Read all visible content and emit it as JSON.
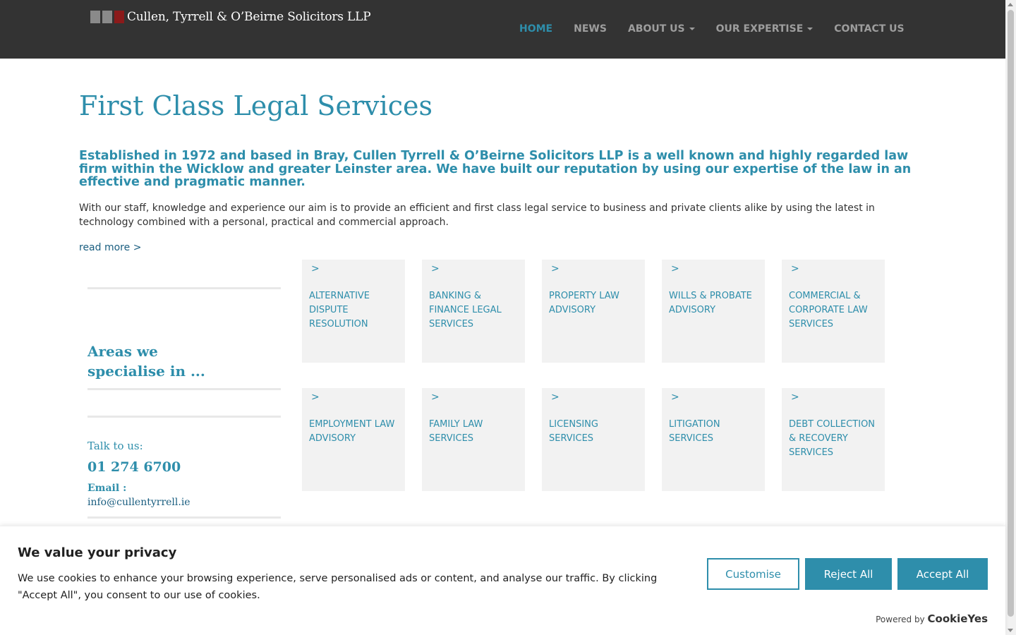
{
  "header": {
    "logo_text": "Cullen, Tyrrell & O’Beirne Solicitors LLP",
    "nav": [
      {
        "label": "HOME",
        "active": true,
        "dropdown": false
      },
      {
        "label": "NEWS",
        "active": false,
        "dropdown": false
      },
      {
        "label": "ABOUT US",
        "active": false,
        "dropdown": true
      },
      {
        "label": "OUR EXPERTISE",
        "active": false,
        "dropdown": true
      },
      {
        "label": "CONTACT US",
        "active": false,
        "dropdown": false
      }
    ]
  },
  "main": {
    "title": "First Class Legal Services",
    "lead": "Established in 1972 and based in Bray, Cullen Tyrrell & O’Beirne Solicitors LLP is a well known and highly regarded law firm within the Wicklow and greater Leinster area. We have built our reputation by using our expertise of the law in an effective and pragmatic manner.",
    "body": "With our staff, knowledge and experience our aim is to provide an efficient and first class legal service to business and private clients alike by using the latest in technology combined with a personal, practical and commercial approach.",
    "read_more": "read more >"
  },
  "sidebar": {
    "areas_heading": "Areas we specialise in ...",
    "talk_label": "Talk to us:",
    "phone": "01 274 6700",
    "email_label": "Email :",
    "email": "info@cullentyrrell.ie"
  },
  "services": [
    {
      "arrow": ">",
      "label": "Alternative Dispute Resolution"
    },
    {
      "arrow": ">",
      "label": "Banking & Finance Legal Services"
    },
    {
      "arrow": ">",
      "label": "Property Law Advisory"
    },
    {
      "arrow": ">",
      "label": "Wills & Probate Advisory"
    },
    {
      "arrow": ">",
      "label": "Commercial & Corporate Law Services"
    },
    {
      "arrow": ">",
      "label": "Employment Law Advisory"
    },
    {
      "arrow": ">",
      "label": "Family Law Services"
    },
    {
      "arrow": ">",
      "label": "Licensing Services"
    },
    {
      "arrow": ">",
      "label": "Litigation Services"
    },
    {
      "arrow": ">",
      "label": "Debt Collection & Recovery Services"
    }
  ],
  "cookie": {
    "title": "We value your privacy",
    "text": "We use cookies to enhance your browsing experience, serve personalised ads or content, and analyse our traffic. By clicking \"Accept All\", you consent to our use of cookies.",
    "customise": "Customise",
    "reject": "Reject All",
    "accept": "Accept All",
    "powered_by": "Powered by",
    "brand": "CookieYes"
  },
  "colors": {
    "accent": "#2e8eab",
    "header_bg": "#333333",
    "tile_bg": "#f2f2f2"
  }
}
